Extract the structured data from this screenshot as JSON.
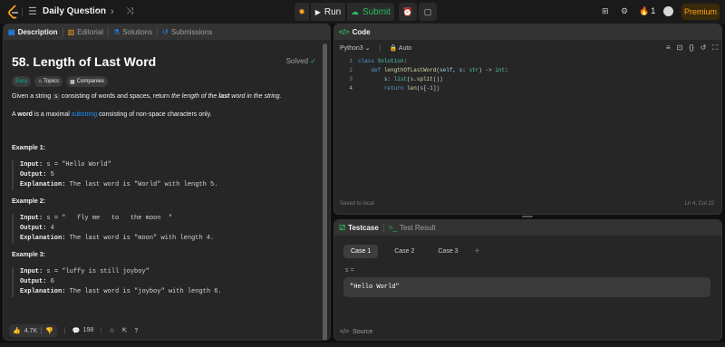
{
  "topbar": {
    "title": "Daily Question",
    "run_label": "Run",
    "submit_label": "Submit",
    "streak": "1",
    "premium_label": "Premium"
  },
  "description": {
    "tabs": [
      "Description",
      "Editorial",
      "Solutions",
      "Submissions"
    ],
    "title": "58. Length of Last Word",
    "solved": "Solved",
    "tags": [
      "Easy",
      "Topics",
      "Companies"
    ],
    "p1_a": "Given a string ",
    "p1_code": "s",
    "p1_b": " consisting of words and spaces, return ",
    "p1_c": "the length of the ",
    "p1_d": "last",
    "p1_e": " word in the string.",
    "p2_a": "A ",
    "p2_b": "word",
    "p2_c": " is a maximal ",
    "p2_d": "substring",
    "p2_e": " consisting of non-space characters only.",
    "examples": [
      {
        "heading": "Example 1:",
        "input": "s = \"Hello World\"",
        "output": "5",
        "explanation": "The last word is \"World\" with length 5."
      },
      {
        "heading": "Example 2:",
        "input": "s = \"   fly me   to   the moon  \"",
        "output": "4",
        "explanation": "The last word is \"moon\" with length 4."
      },
      {
        "heading": "Example 3:",
        "input": "s = \"luffy is still joyboy\"",
        "output": "6",
        "explanation": "The last word is \"joyboy\" with length 6."
      }
    ],
    "labels": {
      "input": "Input:",
      "output": "Output:",
      "explanation": "Explanation:"
    },
    "footer": {
      "likes": "4.7K",
      "comments": "198"
    }
  },
  "code": {
    "tab": "Code",
    "language": "Python3",
    "auto": "Auto",
    "line_numbers": [
      "1",
      "2",
      "3",
      "4"
    ],
    "status": "Saved to local",
    "cursor": "Ln 4, Col 22"
  },
  "testcase": {
    "tabs": [
      "Testcase",
      "Test Result"
    ],
    "cases": [
      "Case 1",
      "Case 2",
      "Case 3"
    ],
    "add": "+",
    "var_label": "s =",
    "value": "\"Hello World\"",
    "source": "Source"
  },
  "colors": {
    "accent": "#ffa116",
    "green": "#2cbb5d",
    "blue": "#1a90ff",
    "easy": "#00b8a3"
  }
}
